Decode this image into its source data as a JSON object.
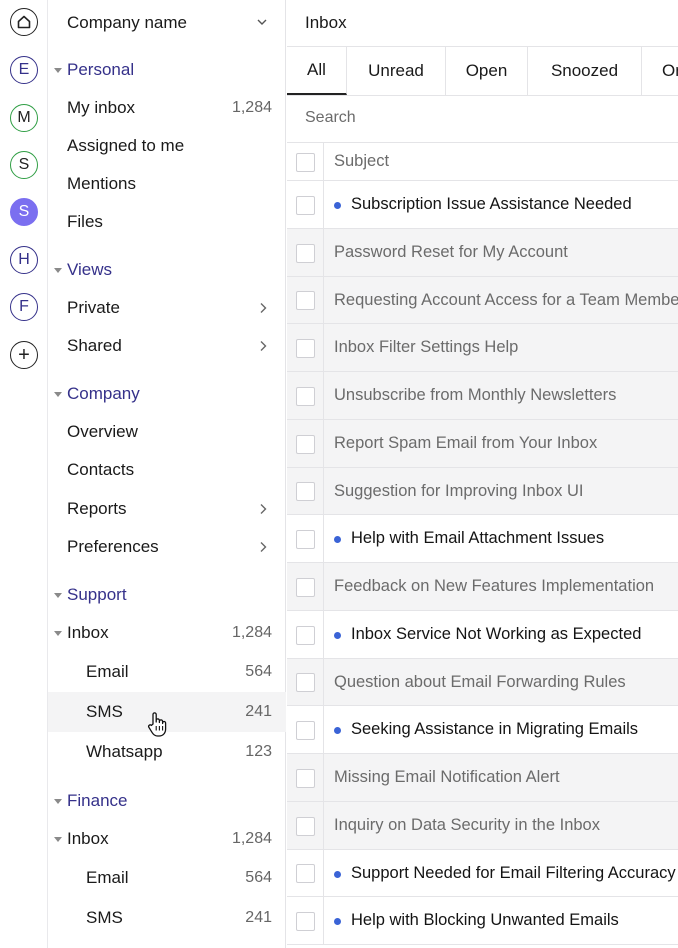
{
  "workspaces": [
    {
      "letter": "",
      "icon": "home-icon",
      "color": "#222222"
    },
    {
      "letter": "E",
      "color": "#35318a"
    },
    {
      "letter": "M",
      "color": "#2f9e44"
    },
    {
      "letter": "S",
      "color": "#2f9e44"
    },
    {
      "letter": "S",
      "color": "#7b6ff0",
      "active": true
    },
    {
      "letter": "H",
      "color": "#35318a"
    },
    {
      "letter": "F",
      "color": "#35318a"
    },
    {
      "letter": "+",
      "icon": "add-icon",
      "color": "#222222"
    }
  ],
  "sidebar": {
    "company_name": "Company name",
    "personal": {
      "heading": "Personal",
      "items": [
        {
          "label": "My inbox",
          "count": "1,284"
        },
        {
          "label": "Assigned to me"
        },
        {
          "label": "Mentions"
        },
        {
          "label": "Files"
        }
      ]
    },
    "views": {
      "heading": "Views",
      "items": [
        {
          "label": "Private"
        },
        {
          "label": "Shared"
        }
      ]
    },
    "company": {
      "heading": "Company",
      "items": [
        {
          "label": "Overview"
        },
        {
          "label": "Contacts"
        },
        {
          "label": "Reports"
        },
        {
          "label": "Preferences"
        }
      ]
    },
    "support": {
      "heading": "Support",
      "inbox": {
        "label": "Inbox",
        "count": "1,284"
      },
      "channels": [
        {
          "label": "Email",
          "count": "564"
        },
        {
          "label": "SMS",
          "count": "241"
        },
        {
          "label": "Whatsapp",
          "count": "123"
        }
      ]
    },
    "finance": {
      "heading": "Finance",
      "inbox": {
        "label": "Inbox",
        "count": "1,284"
      },
      "channels": [
        {
          "label": "Email",
          "count": "564"
        },
        {
          "label": "SMS",
          "count": "241"
        }
      ]
    }
  },
  "main": {
    "title": "Inbox",
    "tabs": [
      "All",
      "Unread",
      "Open",
      "Snoozed",
      "On"
    ],
    "search_placeholder": "Search",
    "subject_header": "Subject",
    "messages": [
      {
        "subject": "Subscription Issue Assistance Needed",
        "unread": true
      },
      {
        "subject": "Password Reset for My Account",
        "unread": false
      },
      {
        "subject": "Requesting Account Access for a Team Member",
        "unread": false
      },
      {
        "subject": "Inbox Filter Settings Help",
        "unread": false
      },
      {
        "subject": "Unsubscribe from Monthly Newsletters",
        "unread": false
      },
      {
        "subject": "Report Spam Email from Your Inbox",
        "unread": false
      },
      {
        "subject": "Suggestion for Improving Inbox UI",
        "unread": false
      },
      {
        "subject": "Help with Email Attachment Issues",
        "unread": true
      },
      {
        "subject": "Feedback on New Features Implementation",
        "unread": false
      },
      {
        "subject": "Inbox Service Not Working as Expected",
        "unread": true
      },
      {
        "subject": "Question about Email Forwarding Rules",
        "unread": false
      },
      {
        "subject": "Seeking Assistance in Migrating Emails",
        "unread": true
      },
      {
        "subject": "Missing Email Notification Alert",
        "unread": false
      },
      {
        "subject": " Inquiry on Data Security in the Inbox",
        "unread": false
      },
      {
        "subject": "Support Needed for Email Filtering Accuracy",
        "unread": true
      },
      {
        "subject": "Help with Blocking Unwanted Emails",
        "unread": true
      }
    ]
  }
}
